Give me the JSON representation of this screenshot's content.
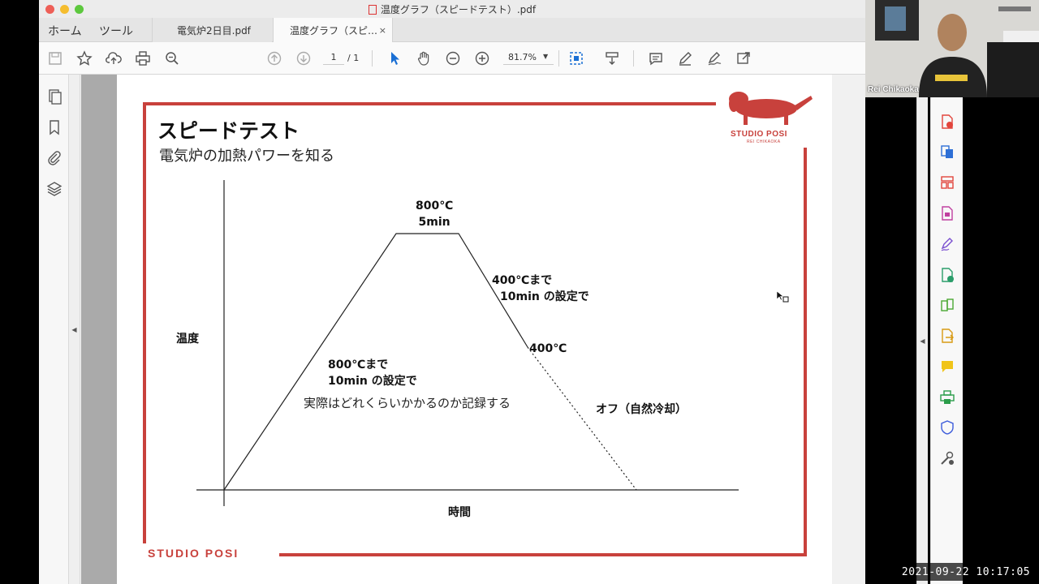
{
  "window": {
    "title": "温度グラフ（スピードテスト）.pdf"
  },
  "tabs": {
    "home": "ホーム",
    "tools": "ツール",
    "documents": [
      {
        "label": "電気炉2日目.pdf"
      },
      {
        "label": "温度グラフ（スピ…",
        "close": "×"
      }
    ]
  },
  "toolbar": {
    "page_current": "1",
    "page_total": "/ 1",
    "zoom": "81.7%",
    "icons": [
      "save-icon",
      "bookmark-star-icon",
      "upload-icon",
      "print-icon",
      "zoom-search-icon",
      "page-up-icon",
      "page-down-icon",
      "select-cursor-icon",
      "hand-icon",
      "zoom-out-icon",
      "zoom-in-icon",
      "fit-page-icon",
      "scroll-mode-icon",
      "comment-icon",
      "highlight-pen-icon",
      "sign-icon",
      "share-icon"
    ]
  },
  "left_panel": {
    "icons": [
      "pages-icon",
      "bookmark-icon",
      "attachment-icon",
      "layers-icon"
    ]
  },
  "right_panel": {
    "icons": [
      "export-pdf-icon",
      "create-pdf-icon",
      "organize-pages-icon",
      "edit-pdf-icon",
      "fill-sign-icon",
      "combine-files-icon",
      "compress-icon",
      "export-icon",
      "comment-tool-icon",
      "print-production-icon",
      "protect-icon",
      "more-tools-icon"
    ]
  },
  "webcam": {
    "name": "Rei Chikaoka"
  },
  "timestamp": "2021-09-22  10:17:05",
  "colors": {
    "accent_red": "#c8413c"
  },
  "slide": {
    "title": "スピードテスト",
    "subtitle": "電気炉の加熱パワーを知る",
    "logo_text": "STUDIO POSI",
    "logo_sub": "REI CHIKAOKA",
    "footer": "STUDIO POSI",
    "annotation_peak_line1": "800℃",
    "annotation_peak_line2": "5min",
    "annotation_cool_line1": "400℃まで",
    "annotation_cool_line2": "10min の設定で",
    "annotation_400": "400℃",
    "annotation_rise_line1": "800℃まで",
    "annotation_rise_line2": "10min の設定で",
    "note": "実際はどれくらいかかるのか記録する",
    "off_label": "オフ（自然冷却）",
    "ylabel": "温度",
    "xlabel": "時間"
  },
  "chart_data": {
    "type": "line",
    "xlabel": "時間",
    "ylabel": "温度",
    "series": [
      {
        "name": "",
        "style": "solid",
        "x": [
          "start",
          "heat end",
          "hold end",
          "400℃ reached"
        ],
        "y": [
          0,
          800,
          800,
          400
        ]
      },
      {
        "name": "",
        "style": "dotted",
        "x": [
          "400℃ reached",
          "end"
        ],
        "y": [
          400,
          0
        ]
      }
    ]
  }
}
